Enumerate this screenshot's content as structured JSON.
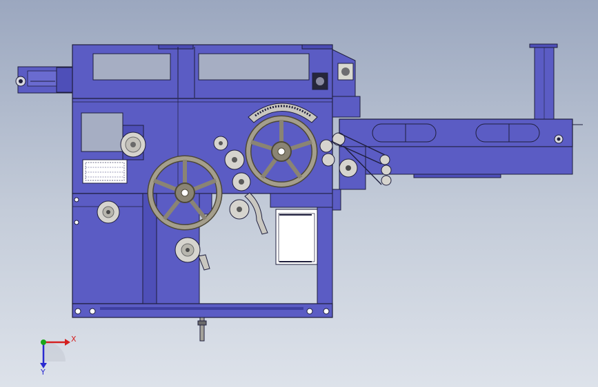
{
  "colors": {
    "frame": "#5b5cc4",
    "frame_dark": "#3e3fa0",
    "outline": "#1e1e3c",
    "window": "#a6aec3",
    "wheel": "#9c9686",
    "wheel_dark": "#4d4838",
    "axis_x": "#d42020",
    "axis_y": "#2a2ad0",
    "axis_origin": "#1aa61a"
  },
  "triad": {
    "x_label": "X",
    "y_label": "Y"
  }
}
